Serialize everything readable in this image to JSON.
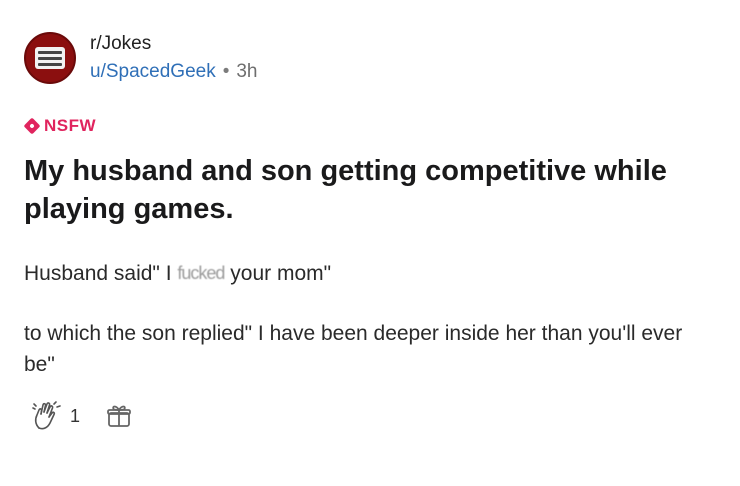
{
  "post": {
    "subreddit": "r/Jokes",
    "username": "u/SpacedGeek",
    "separator": "•",
    "age": "3h",
    "tag": "NSFW",
    "title": "My husband and son getting competitive while playing games.",
    "body": {
      "line1_before": "Husband said\" I ",
      "line1_obscured": "fucked",
      "line1_after": " your mom\"",
      "line2": "to which the son replied\" I have been deeper inside her than you'll ever be\""
    },
    "award_count": "1"
  },
  "colors": {
    "nsfw": "#e0245e",
    "username": "#2f6fb7",
    "avatar": "#8b0f0f"
  },
  "icons": {
    "award": "clapping-hands-icon",
    "gift": "gift-icon",
    "nsfw": "nsfw-diamond-icon"
  }
}
